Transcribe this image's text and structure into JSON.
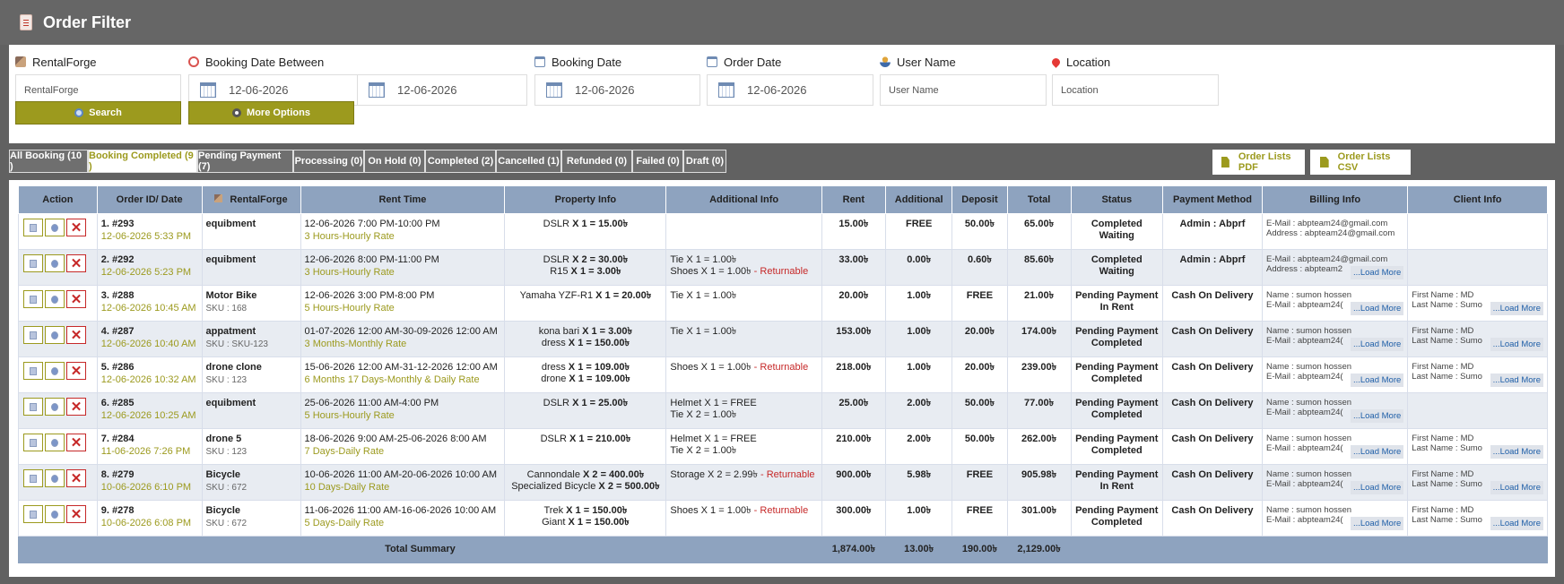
{
  "page": {
    "title": "Order Filter"
  },
  "filters": {
    "rentalforge": {
      "label": "RentalForge",
      "value": "RentalForge"
    },
    "booking_between": {
      "label": "Booking Date Between",
      "from": "12-06-2026",
      "to": "12-06-2026"
    },
    "booking_date": {
      "label": "Booking Date",
      "value": "12-06-2026"
    },
    "order_date": {
      "label": "Order Date",
      "value": "12-06-2026"
    },
    "user_name": {
      "label": "User Name",
      "placeholder": "User Name"
    },
    "location": {
      "label": "Location",
      "placeholder": "Location"
    },
    "search_label": "Search",
    "more_label": "More Options"
  },
  "tabs": [
    {
      "label": "All Booking (10 )",
      "active": false
    },
    {
      "label": "Booking Completed (9 )",
      "active": true
    },
    {
      "label": "Pending Payment (7)",
      "active": false
    },
    {
      "label": "Processing (0)",
      "active": false
    },
    {
      "label": "On Hold (0)",
      "active": false
    },
    {
      "label": "Completed (2)",
      "active": false
    },
    {
      "label": "Cancelled (1)",
      "active": false
    },
    {
      "label": "Refunded (0)",
      "active": false
    },
    {
      "label": "Failed (0)",
      "active": false
    },
    {
      "label": "Draft (0)",
      "active": false
    }
  ],
  "exports": {
    "pdf": "Order Lists PDF",
    "csv": "Order Lists CSV"
  },
  "table": {
    "headers": [
      "Action",
      "Order ID/ Date",
      "RentalForge",
      "Rent Time",
      "Property Info",
      "Additional Info",
      "Rent",
      "Additional",
      "Deposit",
      "Total",
      "Status",
      "Payment Method",
      "Billing Info",
      "Client Info"
    ],
    "load_more": "...Load More",
    "rows": [
      {
        "id": "1. #293",
        "date": "12-06-2026 5:33 PM",
        "product": "equibment",
        "sku": "",
        "time": "12-06-2026 7:00 PM-10:00 PM",
        "rate": "3 Hours-Hourly Rate",
        "property": [
          [
            "DSLR ",
            "X 1 = 15.00৳"
          ]
        ],
        "additional": [],
        "rent": "15.00৳",
        "add": "FREE",
        "deposit": "50.00৳",
        "total": "65.00৳",
        "status": [
          "Completed",
          "Waiting"
        ],
        "payment": "Admin : Abprf",
        "billing": [
          "E-Mail : abpteam24@gmail.com",
          "Address : abpteam24@gmail.com"
        ],
        "billing_more": false,
        "client": [],
        "client_more": false
      },
      {
        "id": "2. #292",
        "date": "12-06-2026 5:23 PM",
        "product": "equibment",
        "sku": "",
        "time": "12-06-2026 8:00 PM-11:00 PM",
        "rate": "3 Hours-Hourly Rate",
        "property": [
          [
            "DSLR ",
            "X 2 = 30.00৳"
          ],
          [
            "R15 ",
            "X 1 = 3.00৳"
          ]
        ],
        "additional": [
          [
            "Tie X 1 = 1.00৳",
            ""
          ],
          [
            "Shoes X 1 = 1.00৳",
            "- Returnable"
          ]
        ],
        "rent": "33.00৳",
        "add": "0.00৳",
        "deposit": "0.60৳",
        "total": "85.60৳",
        "status": [
          "Completed",
          "Waiting"
        ],
        "payment": "Admin : Abprf",
        "billing": [
          "E-Mail : abpteam24@gmail.com",
          "Address : abpteam2"
        ],
        "billing_more": true,
        "client": [],
        "client_more": false
      },
      {
        "id": "3. #288",
        "date": "12-06-2026 10:45 AM",
        "product": "Motor Bike",
        "sku": "SKU : 168",
        "time": "12-06-2026 3:00 PM-8:00 PM",
        "rate": "5 Hours-Hourly Rate",
        "property": [
          [
            "Yamaha YZF-R1 ",
            "X 1 = 20.00৳"
          ]
        ],
        "additional": [
          [
            "Tie X 1 = 1.00৳",
            ""
          ]
        ],
        "rent": "20.00৳",
        "add": "1.00৳",
        "deposit": "FREE",
        "total": "21.00৳",
        "status": [
          "Pending Payment",
          "In Rent"
        ],
        "payment": "Cash On Delivery",
        "billing": [
          "Name : sumon hossen",
          "E-Mail : abpteam24("
        ],
        "billing_more": true,
        "client": [
          "First Name : MD",
          "Last Name : Sumo"
        ],
        "client_more": true
      },
      {
        "id": "4. #287",
        "date": "12-06-2026 10:40 AM",
        "product": "appatment",
        "sku": "SKU : SKU-123",
        "time": "01-07-2026 12:00 AM-30-09-2026 12:00 AM",
        "rate": "3 Months-Monthly Rate",
        "property": [
          [
            "kona bari ",
            "X 1 = 3.00৳"
          ],
          [
            "dress ",
            "X 1 = 150.00৳"
          ]
        ],
        "additional": [
          [
            "Tie X 1 = 1.00৳",
            ""
          ]
        ],
        "rent": "153.00৳",
        "add": "1.00৳",
        "deposit": "20.00৳",
        "total": "174.00৳",
        "status": [
          "Pending Payment",
          "Completed"
        ],
        "payment": "Cash On Delivery",
        "billing": [
          "Name : sumon hossen",
          "E-Mail : abpteam24("
        ],
        "billing_more": true,
        "client": [
          "First Name : MD",
          "Last Name : Sumo"
        ],
        "client_more": true
      },
      {
        "id": "5. #286",
        "date": "12-06-2026 10:32 AM",
        "product": "drone clone",
        "sku": "SKU : 123",
        "time": "15-06-2026 12:00 AM-31-12-2026 12:00 AM",
        "rate": "6 Months 17 Days-Monthly & Daily Rate",
        "property": [
          [
            "dress ",
            "X 1 = 109.00৳"
          ],
          [
            "drone ",
            "X 1 = 109.00৳"
          ]
        ],
        "additional": [
          [
            "Shoes X 1 = 1.00৳",
            "- Returnable"
          ]
        ],
        "rent": "218.00৳",
        "add": "1.00৳",
        "deposit": "20.00৳",
        "total": "239.00৳",
        "status": [
          "Pending Payment",
          "Completed"
        ],
        "payment": "Cash On Delivery",
        "billing": [
          "Name : sumon hossen",
          "E-Mail : abpteam24("
        ],
        "billing_more": true,
        "client": [
          "First Name : MD",
          "Last Name : Sumo"
        ],
        "client_more": true
      },
      {
        "id": "6. #285",
        "date": "12-06-2026 10:25 AM",
        "product": "equibment",
        "sku": "",
        "time": "25-06-2026 11:00 AM-4:00 PM",
        "rate": "5 Hours-Hourly Rate",
        "property": [
          [
            "DSLR ",
            "X 1 = 25.00৳"
          ]
        ],
        "additional": [
          [
            "Helmet X 1 = FREE",
            ""
          ],
          [
            "Tie X 2 = 1.00৳",
            ""
          ]
        ],
        "rent": "25.00৳",
        "add": "2.00৳",
        "deposit": "50.00৳",
        "total": "77.00৳",
        "status": [
          "Pending Payment",
          "Completed"
        ],
        "payment": "Cash On Delivery",
        "billing": [
          "Name : sumon hossen",
          "E-Mail : abpteam24("
        ],
        "billing_more": true,
        "client": [],
        "client_more": false
      },
      {
        "id": "7. #284",
        "date": "11-06-2026 7:26 PM",
        "product": "drone 5",
        "sku": "SKU : 123",
        "time": "18-06-2026 9:00 AM-25-06-2026 8:00 AM",
        "rate": "7 Days-Daily Rate",
        "property": [
          [
            "DSLR ",
            "X 1 = 210.00৳"
          ]
        ],
        "additional": [
          [
            "Helmet X 1 = FREE",
            ""
          ],
          [
            "Tie X 2 = 1.00৳",
            ""
          ]
        ],
        "rent": "210.00৳",
        "add": "2.00৳",
        "deposit": "50.00৳",
        "total": "262.00৳",
        "status": [
          "Pending Payment",
          "Completed"
        ],
        "payment": "Cash On Delivery",
        "billing": [
          "Name : sumon hossen",
          "E-Mail : abpteam24("
        ],
        "billing_more": true,
        "client": [
          "First Name : MD",
          "Last Name : Sumo"
        ],
        "client_more": true
      },
      {
        "id": "8. #279",
        "date": "10-06-2026 6:10 PM",
        "product": "Bicycle",
        "sku": "SKU : 672",
        "time": "10-06-2026 11:00 AM-20-06-2026 10:00 AM",
        "rate": "10 Days-Daily Rate",
        "property": [
          [
            "Cannondale ",
            "X 2 = 400.00৳"
          ],
          [
            "Specialized Bicycle ",
            "X 2 = 500.00৳"
          ]
        ],
        "additional": [
          [
            "Storage X 2 = 2.99৳",
            "- Returnable"
          ]
        ],
        "rent": "900.00৳",
        "add": "5.98৳",
        "deposit": "FREE",
        "total": "905.98৳",
        "status": [
          "Pending Payment",
          "In Rent"
        ],
        "payment": "Cash On Delivery",
        "billing": [
          "Name : sumon hossen",
          "E-Mail : abpteam24("
        ],
        "billing_more": true,
        "client": [
          "First Name : MD",
          "Last Name : Sumo"
        ],
        "client_more": true
      },
      {
        "id": "9. #278",
        "date": "10-06-2026 6:08 PM",
        "product": "Bicycle",
        "sku": "SKU : 672",
        "time": "11-06-2026 11:00 AM-16-06-2026 10:00 AM",
        "rate": "5 Days-Daily Rate",
        "property": [
          [
            "Trek ",
            "X 1 = 150.00৳"
          ],
          [
            "Giant ",
            "X 1 = 150.00৳"
          ]
        ],
        "additional": [
          [
            "Shoes X 1 = 1.00৳",
            "- Returnable"
          ]
        ],
        "rent": "300.00৳",
        "add": "1.00৳",
        "deposit": "FREE",
        "total": "301.00৳",
        "status": [
          "Pending Payment",
          "Completed"
        ],
        "payment": "Cash On Delivery",
        "billing": [
          "Name : sumon hossen",
          "E-Mail : abpteam24("
        ],
        "billing_more": true,
        "client": [
          "First Name : MD",
          "Last Name : Sumo"
        ],
        "client_more": true
      }
    ],
    "summary": {
      "label": "Total Summary",
      "rent": "1,874.00৳",
      "add": "13.00৳",
      "deposit": "190.00৳",
      "total": "2,129.00৳"
    }
  }
}
